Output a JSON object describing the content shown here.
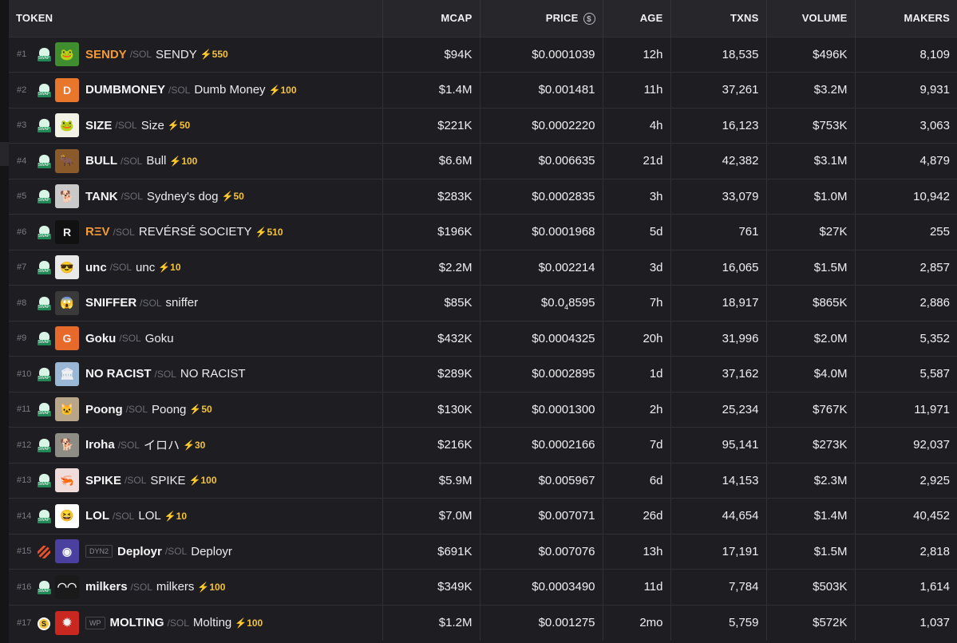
{
  "headers": {
    "token": "TOKEN",
    "mcap": "MCAP",
    "price": "PRICE",
    "price_icon": "dollar-circle-icon",
    "age": "AGE",
    "txns": "TXNS",
    "volume": "VOLUME",
    "makers": "MAKERS"
  },
  "colors": {
    "background": "#1e1e22",
    "header_bg": "#26262b",
    "orange_symbol": "#f39a36",
    "boost_yellow": "#f4c23a",
    "muted": "#7b7b84"
  },
  "rows": [
    {
      "rank": "#1",
      "dex": "SWAP",
      "dex_icon": "raydium-swap-icon",
      "avatar_icon": "frog-avatar",
      "avatar_color": "#3f8d2e",
      "avatar_glyph": "🐸",
      "tag": "",
      "symbol": "SENDY",
      "symbol_orange": true,
      "chain": "SOL",
      "name": "SENDY",
      "boost": "⚡550",
      "mcap": "$94K",
      "price": "$0.0001039",
      "price_parts": null,
      "age": "12h",
      "txns": "18,535",
      "volume": "$496K",
      "makers": "8,109"
    },
    {
      "rank": "#2",
      "dex": "SWAP",
      "dex_icon": "raydium-swap-icon",
      "avatar_icon": "dogecoin-avatar",
      "avatar_color": "#e8762b",
      "avatar_glyph": "D",
      "tag": "",
      "symbol": "DUMBMONEY",
      "symbol_orange": false,
      "chain": "SOL",
      "name": "Dumb Money",
      "boost": "⚡100",
      "mcap": "$1.4M",
      "price": "$0.001481",
      "price_parts": null,
      "age": "11h",
      "txns": "37,261",
      "volume": "$3.2M",
      "makers": "9,931"
    },
    {
      "rank": "#3",
      "dex": "SWAP",
      "dex_icon": "raydium-swap-icon",
      "avatar_icon": "frog-avatar",
      "avatar_color": "#f2f2e6",
      "avatar_glyph": "🐸",
      "tag": "",
      "symbol": "SIZE",
      "symbol_orange": false,
      "chain": "SOL",
      "name": "Size",
      "boost": "⚡50",
      "mcap": "$221K",
      "price": "$0.0002220",
      "price_parts": null,
      "age": "4h",
      "txns": "16,123",
      "volume": "$753K",
      "makers": "3,063"
    },
    {
      "rank": "#4",
      "dex": "SWAP",
      "dex_icon": "raydium-swap-icon",
      "avatar_icon": "bull-avatar",
      "avatar_color": "#8a5a2b",
      "avatar_glyph": "🐂",
      "tag": "",
      "symbol": "BULL",
      "symbol_orange": false,
      "chain": "SOL",
      "name": "Bull",
      "boost": "⚡100",
      "mcap": "$6.6M",
      "price": "$0.006635",
      "price_parts": null,
      "age": "21d",
      "txns": "42,382",
      "volume": "$3.1M",
      "makers": "4,879"
    },
    {
      "rank": "#5",
      "dex": "SWAP",
      "dex_icon": "raydium-swap-icon",
      "avatar_icon": "dog-avatar",
      "avatar_color": "#c9c9c9",
      "avatar_glyph": "🐕",
      "tag": "",
      "symbol": "TANK",
      "symbol_orange": false,
      "chain": "SOL",
      "name": "Sydney's dog",
      "boost": "⚡50",
      "mcap": "$283K",
      "price": "$0.0002835",
      "price_parts": null,
      "age": "3h",
      "txns": "33,079",
      "volume": "$1.0M",
      "makers": "10,942"
    },
    {
      "rank": "#6",
      "dex": "SWAP",
      "dex_icon": "raydium-swap-icon",
      "avatar_icon": "rev-logo-avatar",
      "avatar_color": "#111111",
      "avatar_glyph": "R",
      "tag": "",
      "symbol": "RΞV",
      "symbol_orange": true,
      "chain": "SOL",
      "name": "REVÉRSÉ SOCIETY",
      "boost": "⚡510",
      "mcap": "$196K",
      "price": "$0.0001968",
      "price_parts": null,
      "age": "5d",
      "txns": "761",
      "volume": "$27K",
      "makers": "255"
    },
    {
      "rank": "#7",
      "dex": "SWAP",
      "dex_icon": "raydium-swap-icon",
      "avatar_icon": "sunglasses-face-avatar",
      "avatar_color": "#e9e9e9",
      "avatar_glyph": "😎",
      "tag": "",
      "symbol": "unc",
      "symbol_orange": false,
      "chain": "SOL",
      "name": "unc",
      "boost": "⚡10",
      "mcap": "$2.2M",
      "price": "$0.002214",
      "price_parts": null,
      "age": "3d",
      "txns": "16,065",
      "volume": "$1.5M",
      "makers": "2,857"
    },
    {
      "rank": "#8",
      "dex": "SWAP",
      "dex_icon": "raydium-swap-icon",
      "avatar_icon": "screaming-face-avatar",
      "avatar_color": "#3a3a3a",
      "avatar_glyph": "😱",
      "tag": "",
      "symbol": "SNIFFER",
      "symbol_orange": false,
      "chain": "SOL",
      "name": "sniffer",
      "boost": "",
      "mcap": "$85K",
      "price": "",
      "price_parts": {
        "lead": "$0.0",
        "sub": "4",
        "tail": "8595"
      },
      "age": "7h",
      "txns": "18,917",
      "volume": "$865K",
      "makers": "2,886"
    },
    {
      "rank": "#9",
      "dex": "SWAP",
      "dex_icon": "raydium-swap-icon",
      "avatar_icon": "goku-avatar",
      "avatar_color": "#e86a2a",
      "avatar_glyph": "G",
      "tag": "",
      "symbol": "Goku",
      "symbol_orange": false,
      "chain": "SOL",
      "name": "Goku",
      "boost": "",
      "mcap": "$432K",
      "price": "$0.0004325",
      "price_parts": null,
      "age": "20h",
      "txns": "31,996",
      "volume": "$2.0M",
      "makers": "5,352"
    },
    {
      "rank": "#10",
      "dex": "SWAP",
      "dex_icon": "raydium-swap-icon",
      "avatar_icon": "building-avatar",
      "avatar_color": "#9bb7d6",
      "avatar_glyph": "🏛",
      "tag": "",
      "symbol": "NO RACIST",
      "symbol_orange": false,
      "chain": "SOL",
      "name": "NO RACIST",
      "boost": "",
      "mcap": "$289K",
      "price": "$0.0002895",
      "price_parts": null,
      "age": "1d",
      "txns": "37,162",
      "volume": "$4.0M",
      "makers": "5,587"
    },
    {
      "rank": "#11",
      "dex": "SWAP",
      "dex_icon": "raydium-swap-icon",
      "avatar_icon": "cat-avatar",
      "avatar_color": "#b9a58a",
      "avatar_glyph": "🐱",
      "tag": "",
      "symbol": "Poong",
      "symbol_orange": false,
      "chain": "SOL",
      "name": "Poong",
      "boost": "⚡50",
      "mcap": "$130K",
      "price": "$0.0001300",
      "price_parts": null,
      "age": "2h",
      "txns": "25,234",
      "volume": "$767K",
      "makers": "11,971"
    },
    {
      "rank": "#12",
      "dex": "SWAP",
      "dex_icon": "raydium-swap-icon",
      "avatar_icon": "dog-avatar",
      "avatar_color": "#8d8d86",
      "avatar_glyph": "🐕",
      "tag": "",
      "symbol": "Iroha",
      "symbol_orange": false,
      "chain": "SOL",
      "name": "イロハ",
      "boost": "⚡30",
      "mcap": "$216K",
      "price": "$0.0002166",
      "price_parts": null,
      "age": "7d",
      "txns": "95,141",
      "volume": "$273K",
      "makers": "92,037"
    },
    {
      "rank": "#13",
      "dex": "SWAP",
      "dex_icon": "raydium-swap-icon",
      "avatar_icon": "shrimp-avatar",
      "avatar_color": "#f1dcdc",
      "avatar_glyph": "🦐",
      "tag": "",
      "symbol": "SPIKE",
      "symbol_orange": false,
      "chain": "SOL",
      "name": "SPIKE",
      "boost": "⚡100",
      "mcap": "$5.9M",
      "price": "$0.005967",
      "price_parts": null,
      "age": "6d",
      "txns": "14,153",
      "volume": "$2.3M",
      "makers": "2,925"
    },
    {
      "rank": "#14",
      "dex": "SWAP",
      "dex_icon": "raydium-swap-icon",
      "avatar_icon": "laughing-emoji-avatar",
      "avatar_color": "#ffffff",
      "avatar_glyph": "😆",
      "tag": "",
      "symbol": "LOL",
      "symbol_orange": false,
      "chain": "SOL",
      "name": "LOL",
      "boost": "⚡10",
      "mcap": "$7.0M",
      "price": "$0.007071",
      "price_parts": null,
      "age": "26d",
      "txns": "44,654",
      "volume": "$1.4M",
      "makers": "40,452"
    },
    {
      "rank": "#15",
      "dex": "DYN2",
      "dex_icon": "meteora-stripes-icon",
      "avatar_icon": "deployr-logo-avatar",
      "avatar_color": "#4b3fa0",
      "avatar_glyph": "◉",
      "tag": "DYN2",
      "symbol": "Deployr",
      "symbol_orange": false,
      "chain": "SOL",
      "name": "Deployr",
      "boost": "",
      "mcap": "$691K",
      "price": "$0.007076",
      "price_parts": null,
      "age": "13h",
      "txns": "17,191",
      "volume": "$1.5M",
      "makers": "2,818"
    },
    {
      "rank": "#16",
      "dex": "SWAP",
      "dex_icon": "raydium-swap-icon",
      "avatar_icon": "milkers-avatar",
      "avatar_color": "#1a1a1a",
      "avatar_glyph": "◠◠",
      "tag": "",
      "symbol": "milkers",
      "symbol_orange": false,
      "chain": "SOL",
      "name": "milkers",
      "boost": "⚡100",
      "mcap": "$349K",
      "price": "$0.0003490",
      "price_parts": null,
      "age": "11d",
      "txns": "7,784",
      "volume": "$503K",
      "makers": "1,614"
    },
    {
      "rank": "#17",
      "dex": "WP",
      "dex_icon": "gold-coin-icon",
      "avatar_icon": "red-crab-avatar",
      "avatar_color": "#c8281f",
      "avatar_glyph": "✹",
      "tag": "WP",
      "symbol": "MOLTING",
      "symbol_orange": false,
      "chain": "SOL",
      "name": "Molting",
      "boost": "⚡100",
      "mcap": "$1.2M",
      "price": "$0.001275",
      "price_parts": null,
      "age": "2mo",
      "txns": "5,759",
      "volume": "$572K",
      "makers": "1,037"
    }
  ]
}
